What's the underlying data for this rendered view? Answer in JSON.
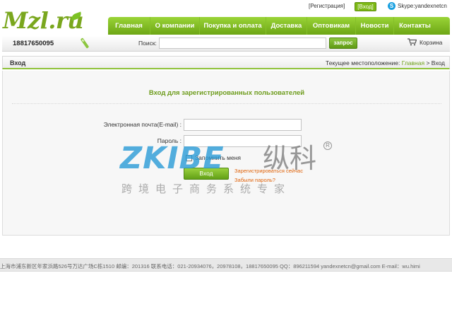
{
  "top_links": {
    "register": "[Регистрация]",
    "login": "[Вход]",
    "skype_icon": "skype-icon",
    "skype": "Skype:yandexnetcn"
  },
  "logo": {
    "text": "Mzl.ru"
  },
  "nav": {
    "items": [
      {
        "label": "Главная",
        "width": 60
      },
      {
        "label": "О компании",
        "width": 70
      },
      {
        "label": "Покупка и оплата",
        "width": 94
      },
      {
        "label": "Доставка",
        "width": 58
      },
      {
        "label": "Оптовикам",
        "width": 69
      },
      {
        "label": "Новости",
        "width": 54
      },
      {
        "label": "Контакты",
        "width": 59
      }
    ]
  },
  "search_bar": {
    "phone": "18817650095",
    "label": "Поиск:",
    "query": "",
    "button": "запрос",
    "cart": "Корзина"
  },
  "breadcrumb": {
    "title": "Вход",
    "prefix": "Текущее местоположение: ",
    "home": "Главная",
    "separator": " > ",
    "current": "Вход"
  },
  "login_form": {
    "title": "Вход для зарегистрированных пользователей",
    "email_label": "Электронная почта(E-mail) :",
    "email_value": "",
    "password_label": "Пароль :",
    "password_value": "",
    "remember_label": "Запомнить меня",
    "submit": "Вход",
    "register_link": "Зарегистрироваться сейчас",
    "forgot_link": "Забыли пароль?"
  },
  "watermark": {
    "brand": "ZKIBE",
    "cn": "纵科",
    "reg": "R",
    "slogan": "跨境电子商务系统专家"
  },
  "footer": {
    "text": "上海市浦东新区年家浜路526号万达广场C栋1510 邮编：201316 联系电话：021-20934076，20978108，18817650095 QQ：896211594 yandexnetcn@gmail.com E-mail：wu.himi"
  },
  "colors": {
    "accent": "#7aa71e",
    "nav_top": "#9ad437",
    "nav_bottom": "#6da615",
    "link_orange": "#e0640c",
    "watermark_blue": "#2498d6"
  }
}
